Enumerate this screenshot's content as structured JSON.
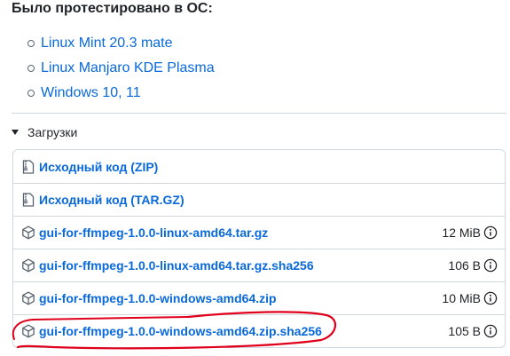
{
  "os_section": {
    "heading": "Было протестировано в ОС:",
    "items": [
      "Linux Mint 20.3 mate",
      "Linux Manjaro KDE Plasma",
      "Windows 10, 11"
    ]
  },
  "downloads": {
    "summary": "Загрузки",
    "assets": [
      {
        "name": "Исходный код (ZIP)",
        "size": "",
        "icon": "file-zip-icon"
      },
      {
        "name": "Исходный код (TAR.GZ)",
        "size": "",
        "icon": "file-zip-icon"
      },
      {
        "name": "gui-for-ffmpeg-1.0.0-linux-amd64.tar.gz",
        "size": "12 MiB",
        "icon": "package-icon"
      },
      {
        "name": "gui-for-ffmpeg-1.0.0-linux-amd64.tar.gz.sha256",
        "size": "106 B",
        "icon": "package-icon"
      },
      {
        "name": "gui-for-ffmpeg-1.0.0-windows-amd64.zip",
        "size": "10 MiB",
        "icon": "package-icon"
      },
      {
        "name": "gui-for-ffmpeg-1.0.0-windows-amd64.zip.sha256",
        "size": "105 B",
        "icon": "package-icon"
      }
    ]
  },
  "colors": {
    "link": "#0969da",
    "text": "#1f2328",
    "border": "#d1d9e0",
    "annotation": "#e0001b"
  }
}
